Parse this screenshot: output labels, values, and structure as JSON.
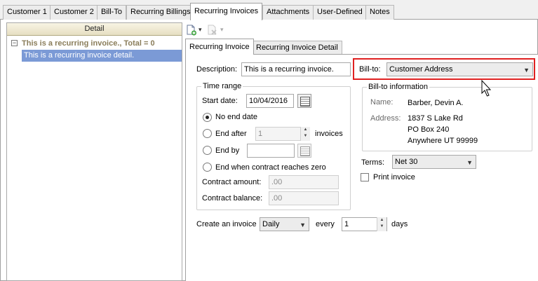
{
  "top_tabs": [
    "Customer 1",
    "Customer 2",
    "Bill-To",
    "Recurring Billings",
    "Recurring Invoices",
    "Attachments",
    "User-Defined",
    "Notes"
  ],
  "tree": {
    "header": "Detail",
    "group_label": "This is a recurring invoice., Total = 0",
    "expander": "−",
    "row": "This is a recurring invoice detail."
  },
  "toolbar": {
    "new_icon": "new-document-icon",
    "delete_icon": "delete-icon",
    "dropdown_glyph": "▾"
  },
  "inner_tabs": [
    "Recurring Invoice",
    "Recurring Invoice Detail"
  ],
  "form": {
    "description_label": "Description:",
    "description_value": "This is a recurring invoice.",
    "billto_label": "Bill-to:",
    "billto_value": "Customer Address",
    "time_range": {
      "title": "Time range",
      "start_date_label": "Start date:",
      "start_date_value": "10/04/2016",
      "no_end_label": "No end date",
      "end_after_label": "End after",
      "end_after_value": "1",
      "invoices_label": "invoices",
      "end_by_label": "End by",
      "end_by_value": "",
      "contract_zero_label": "End when contract reaches zero",
      "contract_amount_label": "Contract amount:",
      "contract_amount_value": ".00",
      "contract_balance_label": "Contract balance:",
      "contract_balance_value": ".00"
    },
    "billto_info": {
      "title": "Bill-to information",
      "name_label": "Name:",
      "name_value": "Barber, Devin A.",
      "address_label": "Address:",
      "address_line1": "1837 S Lake Rd",
      "address_line2": "PO Box 240",
      "address_line3": "Anywhere UT 99999"
    },
    "terms_label": "Terms:",
    "terms_value": "Net 30",
    "print_invoice_label": "Print invoice",
    "create_label": "Create an invoice",
    "frequency_value": "Daily",
    "every_label": "every",
    "every_value": "1",
    "days_label": "days"
  },
  "colors": {
    "highlight_border": "#e02020",
    "selected_row": "#7b9ad6",
    "group_text": "#8a7d5a"
  }
}
